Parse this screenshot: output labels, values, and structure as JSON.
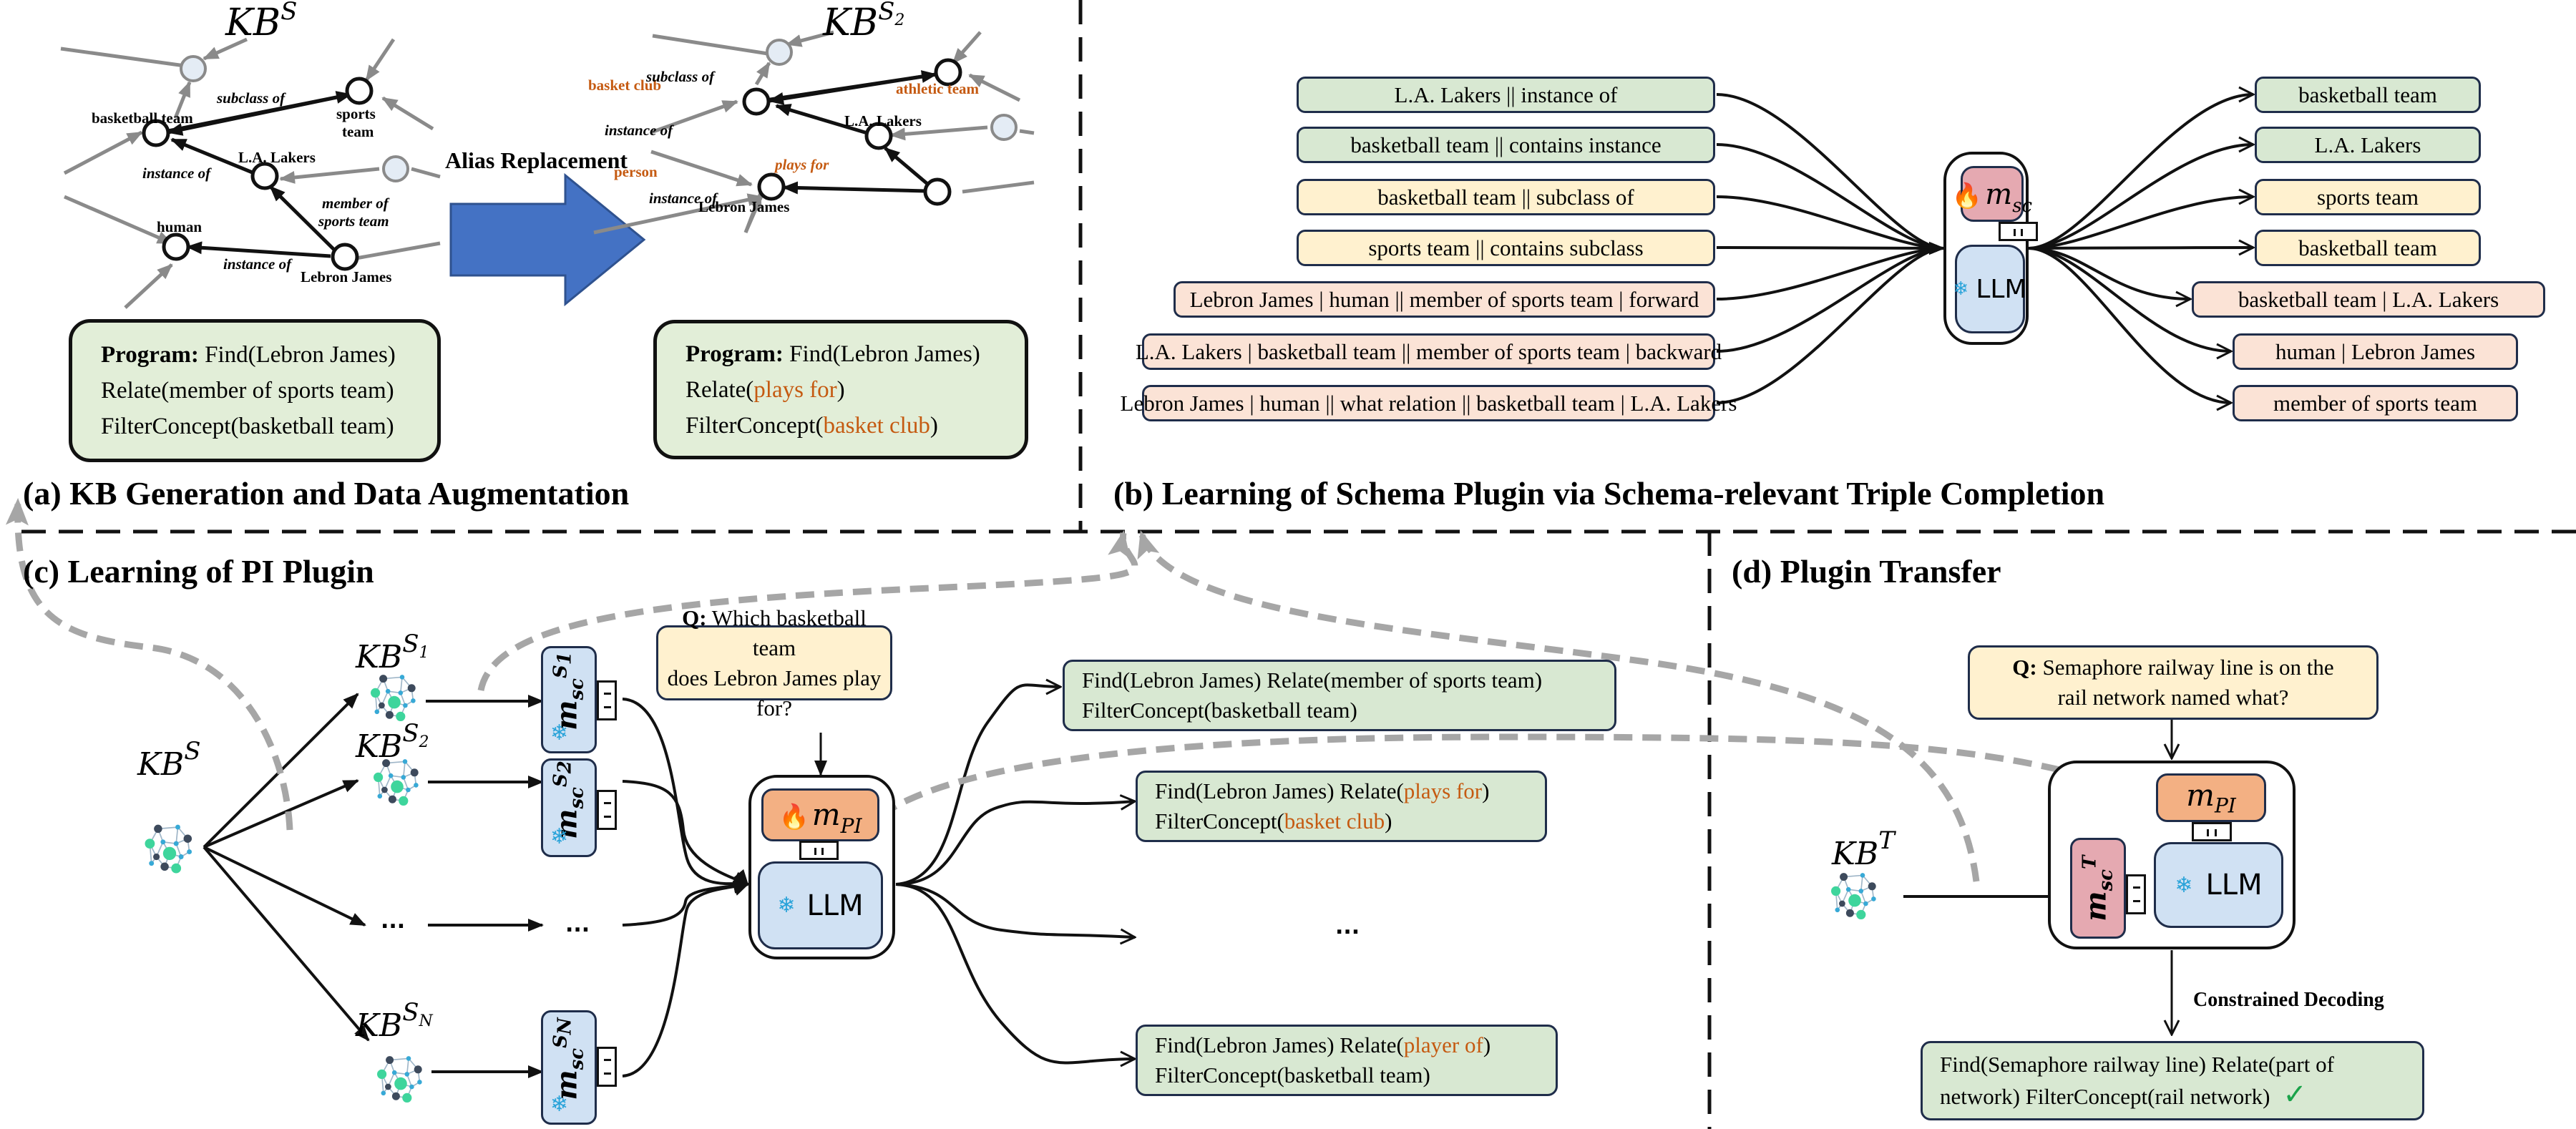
{
  "colors": {
    "kb_panel": "#dbe8f8",
    "program_box": "#e2eed8",
    "entity_green": "#d8e8d2",
    "concept_yellow": "#fff1cf",
    "relation_peach": "#fbe3d6",
    "alias_orange": "#c55a11",
    "schema_plugin": "#e5a9b1",
    "pi_plugin": "#f3b083",
    "llm": "#d0e1f3",
    "alias_arrow": "#4472c4",
    "dashed_link": "#a6a6a6",
    "check": "#1aa34a"
  },
  "section_a": {
    "title": "(a) KB Generation and Data Augmentation",
    "arrow_label": "Alias Replacement",
    "kb_source": {
      "title_base": "KB",
      "title_sup": "S",
      "nodes": {
        "basketball_team": "basketball team",
        "sports_team_1": "sports",
        "sports_team_2": "team",
        "lakers": "L.A. Lakers",
        "human": "human",
        "lebron": "Lebron James"
      },
      "edges": {
        "subclass": "subclass of",
        "instance_team": "instance of",
        "member_1": "member of",
        "member_2": "sports team",
        "instance_human": "instance of"
      },
      "program": {
        "label": "Program:",
        "line1": "Find(Lebron James)",
        "line2": "Relate(member of sports team)",
        "line3": "FilterConcept(basketball team)"
      }
    },
    "kb_aug": {
      "title_base": "KB",
      "title_sup": "S",
      "title_sub": "2",
      "nodes": {
        "basket_club": "basket club",
        "athletic_team": "athletic team",
        "lakers": "L.A. Lakers",
        "person": "person",
        "lebron": "Lebron James"
      },
      "edges": {
        "subclass": "subclass of",
        "instance_team": "instance of",
        "plays_for": "plays for",
        "instance_person": "instance of"
      },
      "program": {
        "label": "Program:",
        "line1": "Find(Lebron James)",
        "line2_pre": "Relate(",
        "line2_alias": "plays for",
        "line2_post": ")",
        "line3_pre": "FilterConcept(",
        "line3_alias": "basket club",
        "line3_post": ")"
      }
    }
  },
  "section_b": {
    "title": "(b) Learning of Schema Plugin via Schema-relevant Triple Completion",
    "inputs": [
      {
        "text": "L.A. Lakers || instance of",
        "type": "green"
      },
      {
        "text": "basketball team || contains instance",
        "type": "green"
      },
      {
        "text": "basketball team || subclass of",
        "type": "yellow"
      },
      {
        "text": "sports team || contains subclass",
        "type": "yellow"
      },
      {
        "text": "Lebron James | human || member of sports team | forward",
        "type": "peach"
      },
      {
        "text": "L.A. Lakers | basketball team || member of sports team | backward",
        "type": "peach"
      },
      {
        "text": "Lebron James | human || what relation || basketball team | L.A. Lakers",
        "type": "peach"
      }
    ],
    "outputs": [
      {
        "text": "basketball team",
        "type": "green"
      },
      {
        "text": "L.A. Lakers",
        "type": "green"
      },
      {
        "text": "sports team",
        "type": "yellow"
      },
      {
        "text": "basketball team",
        "type": "yellow"
      },
      {
        "text": "basketball team | L.A. Lakers",
        "type": "peach"
      },
      {
        "text": "human | Lebron James",
        "type": "peach"
      },
      {
        "text": "member of sports team",
        "type": "peach"
      }
    ],
    "plugin": {
      "base": "m",
      "sub": "sc",
      "icon": "flame-icon",
      "trainable": true
    },
    "llm": {
      "label": "LLM",
      "icon": "snowflake-icon",
      "frozen": true
    }
  },
  "section_c": {
    "title": "(c) Learning of PI Plugin",
    "source_kb": {
      "base": "KB",
      "sup": "S"
    },
    "kbs": [
      {
        "base": "KB",
        "sup": "S",
        "sup_sub": "1"
      },
      {
        "base": "KB",
        "sup": "S",
        "sup_sub": "2"
      },
      {
        "base": "...",
        "sup": "",
        "sup_sub": ""
      },
      {
        "base": "KB",
        "sup": "S",
        "sup_sub": "N"
      }
    ],
    "plugins": [
      {
        "base": "m",
        "sub": "sc",
        "sup": "S",
        "sup_sub": "1"
      },
      {
        "base": "m",
        "sub": "sc",
        "sup": "S",
        "sup_sub": "2"
      },
      {
        "base": "...",
        "sub": "",
        "sup": "",
        "sup_sub": ""
      },
      {
        "base": "m",
        "sub": "sc",
        "sup": "S",
        "sup_sub": "N"
      }
    ],
    "question": {
      "label": "Q:",
      "text_1": "Which basketball team",
      "text_2": "does Lebron James play for?"
    },
    "plugin": {
      "base": "m",
      "sub": "PI",
      "icon": "flame-icon",
      "trainable": true
    },
    "llm": {
      "label": "LLM",
      "icon": "snowflake-icon",
      "frozen": true
    },
    "outputs": [
      {
        "line1_pre": "Find(Lebron James) Relate(member of sports team)",
        "line1_alias": "",
        "line1_post": "",
        "line2_pre": "FilterConcept(basketball team)",
        "line2_alias": "",
        "line2_post": ""
      },
      {
        "line1_pre": "Find(Lebron James) Relate(",
        "line1_alias": "plays for",
        "line1_post": ")",
        "line2_pre": "FilterConcept(",
        "line2_alias": "basket club",
        "line2_post": ")"
      },
      {
        "line1_pre": "Find(Lebron James) Relate(",
        "line1_alias": "player of",
        "line1_post": ")",
        "line2_pre": "FilterConcept(basketball team)",
        "line2_alias": "",
        "line2_post": ""
      }
    ],
    "ellipsis": "..."
  },
  "section_d": {
    "title": "(d) Plugin Transfer",
    "target_kb": {
      "base": "KB",
      "sup": "T"
    },
    "question": {
      "label": "Q:",
      "text_1": "Semaphore railway line is on the",
      "text_2": "rail network named what?"
    },
    "pi_plugin": {
      "base": "m",
      "sub": "PI"
    },
    "sc_plugin": {
      "base": "m",
      "sub": "sc",
      "sup": "T"
    },
    "llm": {
      "label": "LLM",
      "icon": "snowflake-icon"
    },
    "decoding_label": "Constrained Decoding",
    "output": {
      "line1": "Find(Semaphore railway line) Relate(part of",
      "line2": "network) FilterConcept(rail network)",
      "status": "correct"
    }
  }
}
